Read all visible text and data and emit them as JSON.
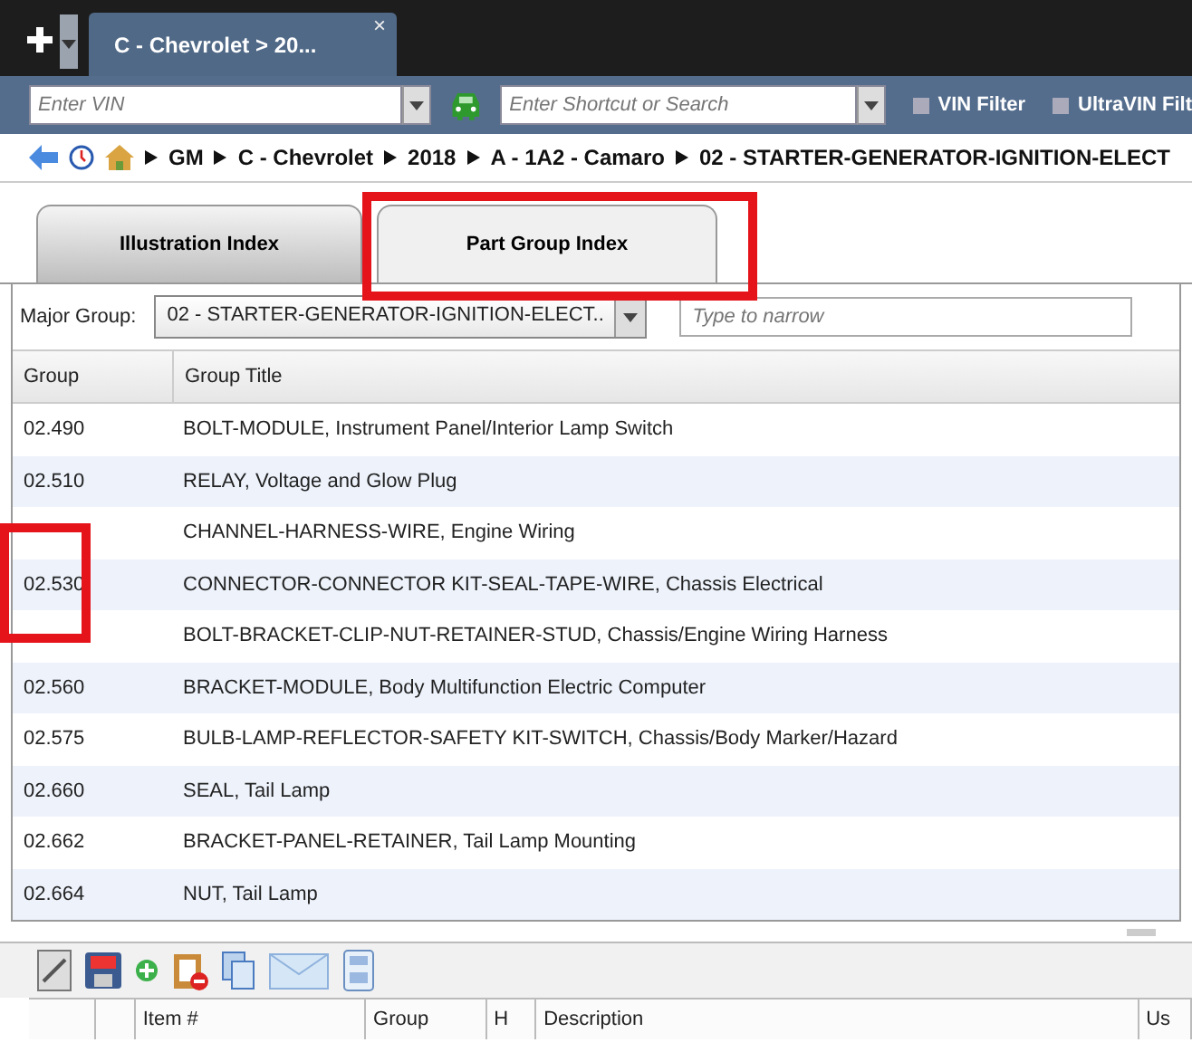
{
  "top_tab": {
    "label": "C - Chevrolet > 20...",
    "close": "×"
  },
  "vin_field": {
    "placeholder": "Enter VIN"
  },
  "search_field": {
    "placeholder": "Enter Shortcut or Search"
  },
  "filters": [
    {
      "label": "VIN Filter",
      "checked": false
    },
    {
      "label": "UltraVIN Filt",
      "checked": false
    }
  ],
  "breadcrumb": [
    "GM",
    "C - Chevrolet",
    "2018",
    "A - 1A2 - Camaro",
    "02 - STARTER-GENERATOR-IGNITION-ELECT"
  ],
  "tabs": [
    {
      "label": "Illustration Index",
      "selected": false
    },
    {
      "label": "Part Group Index",
      "selected": true
    }
  ],
  "major_group": {
    "label": "Major Group:",
    "value": "02 - STARTER-GENERATOR-IGNITION-ELECT..",
    "filter_placeholder": "Type to narrow"
  },
  "table": {
    "columns": [
      "Group",
      "Group Title"
    ],
    "rows": [
      {
        "group": "02.490",
        "title": "BOLT-MODULE, Instrument Panel/Interior Lamp Switch"
      },
      {
        "group": "02.510",
        "title": "RELAY, Voltage and Glow Plug"
      },
      {
        "title": "CHANNEL-HARNESS-WIRE, Engine Wiring"
      },
      {
        "group": "02.530",
        "title": "CONNECTOR-CONNECTOR KIT-SEAL-TAPE-WIRE, Chassis Electrical"
      },
      {
        "title": "BOLT-BRACKET-CLIP-NUT-RETAINER-STUD, Chassis/Engine Wiring Harness"
      },
      {
        "group": "02.560",
        "title": "BRACKET-MODULE, Body Multifunction Electric Computer"
      },
      {
        "group": "02.575",
        "title": "BULB-LAMP-REFLECTOR-SAFETY KIT-SWITCH, Chassis/Body Marker/Hazard"
      },
      {
        "group": "02.660",
        "title": "SEAL, Tail Lamp"
      },
      {
        "group": "02.662",
        "title": "BRACKET-PANEL-RETAINER, Tail Lamp Mounting"
      },
      {
        "group": "02.664",
        "title": "NUT, Tail Lamp"
      }
    ]
  },
  "parts_table": {
    "columns": [
      "",
      "",
      "Item #",
      "Group",
      "H",
      "Description",
      "Us"
    ]
  }
}
